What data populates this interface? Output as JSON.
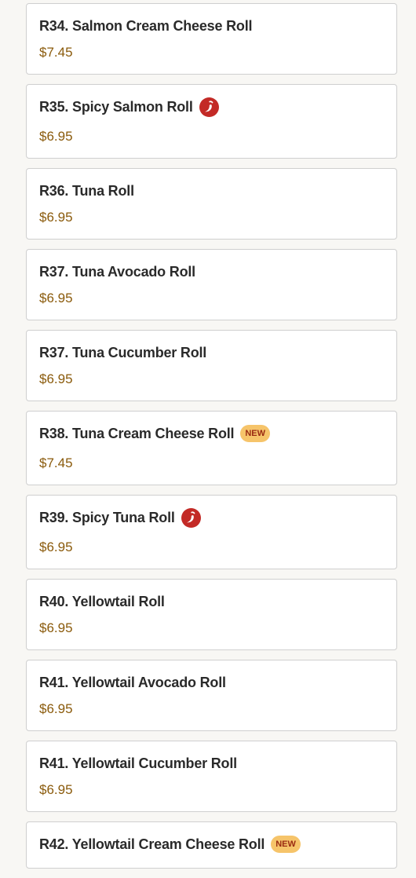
{
  "badges": {
    "new_label": "NEW",
    "spicy_icon": "chili-pepper-icon"
  },
  "colors": {
    "price": "#8a5a0b",
    "spicy": "#c32a26",
    "new_badge_bg": "#f6c46a",
    "new_badge_text": "#9a2a12"
  },
  "items": [
    {
      "name": "R34. Salmon Cream Cheese Roll",
      "price": "$7.45"
    },
    {
      "name": "R35. Spicy Salmon Roll",
      "price": "$6.95",
      "spicy": true
    },
    {
      "name": "R36. Tuna Roll",
      "price": "$6.95"
    },
    {
      "name": "R37. Tuna Avocado Roll",
      "price": "$6.95"
    },
    {
      "name": "R37. Tuna Cucumber Roll",
      "price": "$6.95"
    },
    {
      "name": "R38. Tuna Cream Cheese Roll",
      "price": "$7.45",
      "new": true
    },
    {
      "name": "R39. Spicy Tuna Roll",
      "price": "$6.95",
      "spicy": true
    },
    {
      "name": "R40. Yellowtail Roll",
      "price": "$6.95"
    },
    {
      "name": "R41. Yellowtail Avocado Roll",
      "price": "$6.95"
    },
    {
      "name": "R41. Yellowtail Cucumber Roll",
      "price": "$6.95"
    },
    {
      "name": "R42. Yellowtail Cream Cheese Roll",
      "new": true
    }
  ]
}
